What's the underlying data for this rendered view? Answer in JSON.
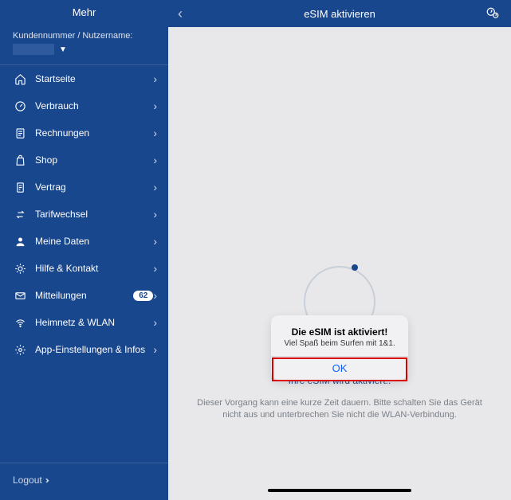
{
  "sidebar": {
    "title": "Mehr",
    "customer_label": "Kundennummer / Nutzername:",
    "items": [
      {
        "label": "Startseite",
        "icon": "home"
      },
      {
        "label": "Verbrauch",
        "icon": "gauge"
      },
      {
        "label": "Rechnungen",
        "icon": "invoice"
      },
      {
        "label": "Shop",
        "icon": "bag"
      },
      {
        "label": "Vertrag",
        "icon": "contract"
      },
      {
        "label": "Tarifwechsel",
        "icon": "swap"
      },
      {
        "label": "Meine Daten",
        "icon": "user"
      },
      {
        "label": "Hilfe & Kontakt",
        "icon": "help"
      },
      {
        "label": "Mitteilungen",
        "icon": "mail",
        "badge": "62"
      },
      {
        "label": "Heimnetz & WLAN",
        "icon": "wifi"
      },
      {
        "label": "App-Einstellungen & Infos",
        "icon": "gear"
      }
    ],
    "logout": "Logout"
  },
  "topbar": {
    "title": "eSIM aktivieren"
  },
  "content": {
    "status": "Ihre eSIM wird aktiviert..",
    "hint": "Dieser Vorgang kann eine kurze Zeit dauern. Bitte schalten Sie das Gerät nicht aus und unterbrechen Sie nicht die WLAN-Verbindung."
  },
  "dialog": {
    "title": "Die eSIM ist aktiviert!",
    "message": "Viel Spaß beim Surfen mit 1&1.",
    "ok": "OK"
  }
}
